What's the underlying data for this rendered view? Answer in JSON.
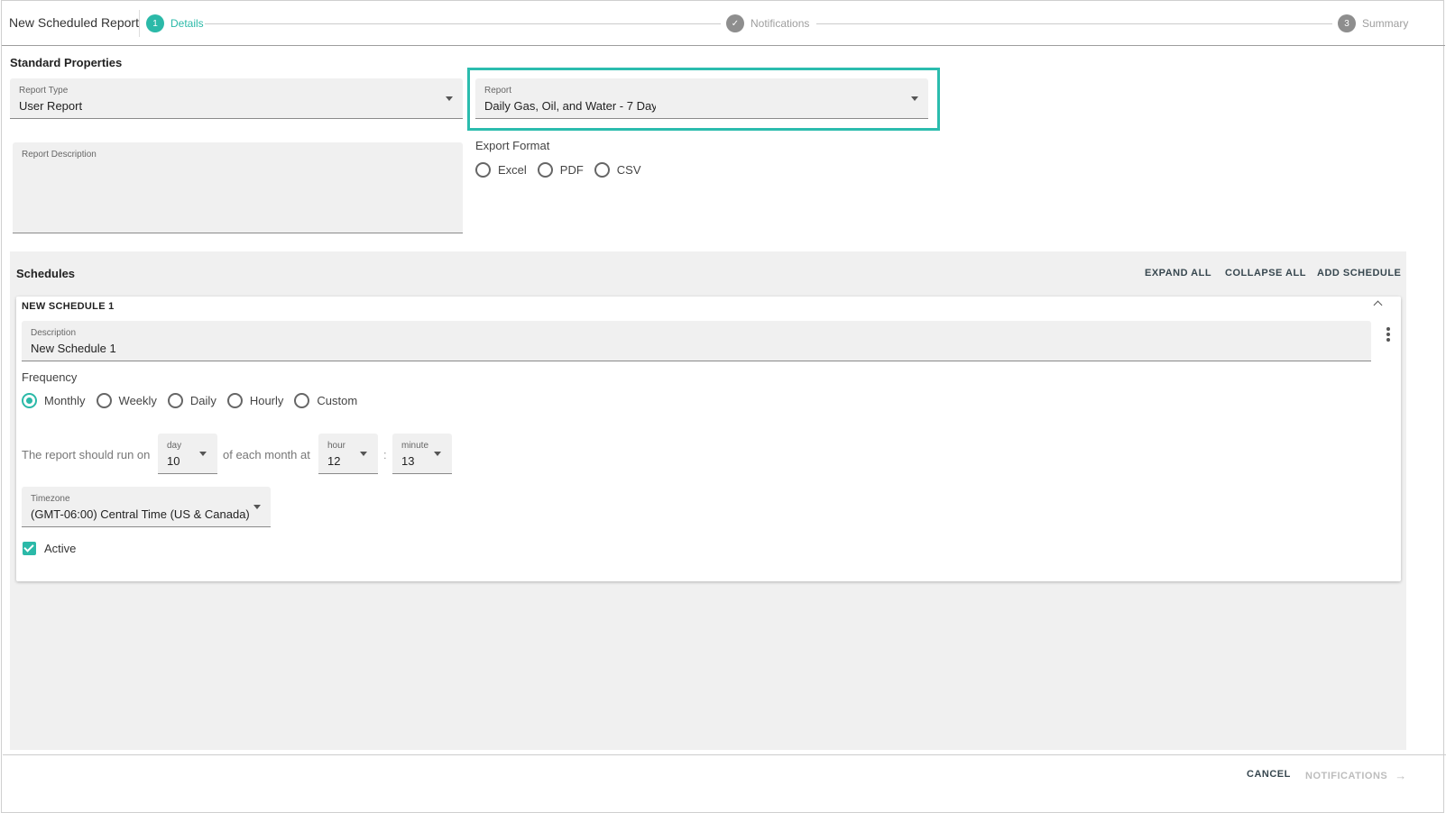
{
  "header": {
    "title": "New Scheduled Report",
    "steps": [
      {
        "number": "1",
        "label": "Details",
        "state": "active"
      },
      {
        "number": "✓",
        "label": "Notifications",
        "state": "complete"
      },
      {
        "number": "3",
        "label": "Summary",
        "state": "pending"
      }
    ]
  },
  "standard": {
    "title": "Standard Properties",
    "report_type": {
      "label": "Report Type",
      "value": "User Report"
    },
    "report": {
      "label": "Report",
      "value": "Daily Gas, Oil, and Water - 7 Day"
    },
    "description": {
      "label": "Report Description",
      "value": ""
    },
    "export": {
      "label": "Export Format",
      "options": [
        "Excel",
        "PDF",
        "CSV"
      ],
      "selected": ""
    }
  },
  "schedules": {
    "title": "Schedules",
    "expand_all": "EXPAND ALL",
    "collapse_all": "COLLAPSE ALL",
    "add_schedule": "ADD SCHEDULE",
    "schedule": {
      "title": "NEW SCHEDULE 1",
      "description": {
        "label": "Description",
        "value": "New Schedule 1"
      },
      "frequency_label": "Frequency",
      "frequency_options": [
        "Monthly",
        "Weekly",
        "Daily",
        "Hourly",
        "Custom"
      ],
      "frequency_selected": "Monthly",
      "run_text_1": "The report should run on",
      "run_text_2": "of each month at",
      "time_separator": ":",
      "day": {
        "label": "day",
        "value": "10"
      },
      "hour": {
        "label": "hour",
        "value": "12"
      },
      "minute": {
        "label": "minute",
        "value": "13"
      },
      "timezone": {
        "label": "Timezone",
        "value": "(GMT-06:00) Central Time (US & Canada)"
      },
      "active_label": "Active",
      "active": true
    }
  },
  "footer": {
    "cancel": "CANCEL",
    "next": "NOTIFICATIONS"
  },
  "colors": {
    "accent": "#2bb9a8",
    "highlight": "#2bbcae"
  }
}
